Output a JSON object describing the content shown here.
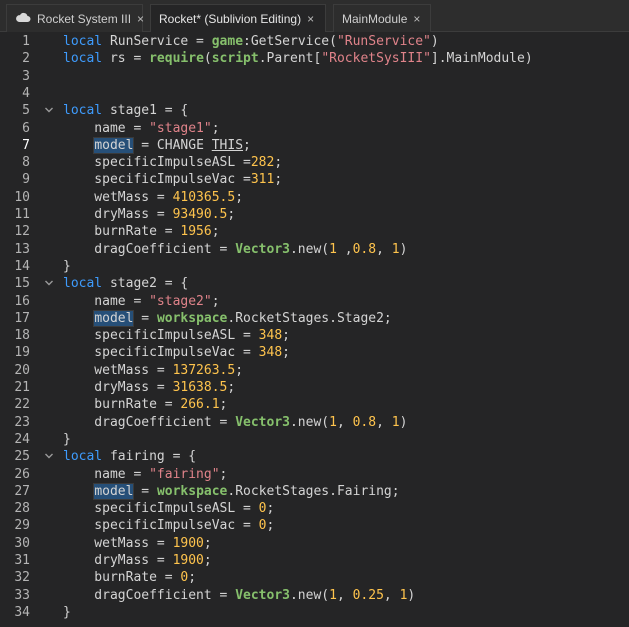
{
  "tabs": [
    {
      "label": "Rocket System III",
      "active": false,
      "icon": "cloud-icon"
    },
    {
      "label": "Rocket* (Sublivion Editing)",
      "active": true
    },
    {
      "label": "MainModule",
      "active": false
    }
  ],
  "close_glyph": "×",
  "current_line": 7,
  "colors": {
    "keyword": "#3e9bfc",
    "string": "#e0838a",
    "number": "#ffc44d",
    "builtin": "#86c06c",
    "text": "#d4d4d4",
    "background": "#252526"
  },
  "lines": [
    {
      "n": "1",
      "fold": false,
      "tokens": [
        {
          "t": "local",
          "c": "kw"
        },
        {
          "t": " RunService = "
        },
        {
          "t": "game",
          "c": "bi"
        },
        {
          "t": ":GetService("
        },
        {
          "t": "\"RunService\"",
          "c": "str"
        },
        {
          "t": ")"
        }
      ]
    },
    {
      "n": "2",
      "fold": false,
      "tokens": [
        {
          "t": "local",
          "c": "kw"
        },
        {
          "t": " rs = "
        },
        {
          "t": "require",
          "c": "bi"
        },
        {
          "t": "("
        },
        {
          "t": "script",
          "c": "bi"
        },
        {
          "t": ".Parent["
        },
        {
          "t": "\"RocketSysIII\"",
          "c": "str"
        },
        {
          "t": "].MainModule)"
        }
      ]
    },
    {
      "n": "3",
      "fold": false,
      "tokens": []
    },
    {
      "n": "4",
      "fold": false,
      "tokens": []
    },
    {
      "n": "5",
      "fold": true,
      "tokens": [
        {
          "t": "local",
          "c": "kw"
        },
        {
          "t": " stage1 = {"
        }
      ]
    },
    {
      "n": "6",
      "fold": false,
      "tokens": [
        {
          "t": "    name = "
        },
        {
          "t": "\"stage1\"",
          "c": "str"
        },
        {
          "t": ";"
        }
      ]
    },
    {
      "n": "7",
      "fold": false,
      "tokens": [
        {
          "t": "    "
        },
        {
          "t": "model",
          "c": "hl"
        },
        {
          "t": " = CHANGE "
        },
        {
          "t": "THIS",
          "c": "ul"
        },
        {
          "t": ";"
        }
      ]
    },
    {
      "n": "8",
      "fold": false,
      "tokens": [
        {
          "t": "    specificImpulseASL ="
        },
        {
          "t": "282",
          "c": "num"
        },
        {
          "t": ";"
        }
      ]
    },
    {
      "n": "9",
      "fold": false,
      "tokens": [
        {
          "t": "    specificImpulseVac ="
        },
        {
          "t": "311",
          "c": "num"
        },
        {
          "t": ";"
        }
      ]
    },
    {
      "n": "10",
      "fold": false,
      "tokens": [
        {
          "t": "    wetMass = "
        },
        {
          "t": "410365.5",
          "c": "num"
        },
        {
          "t": ";"
        }
      ]
    },
    {
      "n": "11",
      "fold": false,
      "tokens": [
        {
          "t": "    dryMass = "
        },
        {
          "t": "93490.5",
          "c": "num"
        },
        {
          "t": ";"
        }
      ]
    },
    {
      "n": "12",
      "fold": false,
      "tokens": [
        {
          "t": "    burnRate = "
        },
        {
          "t": "1956",
          "c": "num"
        },
        {
          "t": ";"
        }
      ]
    },
    {
      "n": "13",
      "fold": false,
      "tokens": [
        {
          "t": "    dragCoefficient = "
        },
        {
          "t": "Vector3",
          "c": "bi"
        },
        {
          "t": ".new("
        },
        {
          "t": "1",
          "c": "num"
        },
        {
          "t": " ,"
        },
        {
          "t": "0.8",
          "c": "num"
        },
        {
          "t": ", "
        },
        {
          "t": "1",
          "c": "num"
        },
        {
          "t": ")"
        }
      ]
    },
    {
      "n": "14",
      "fold": false,
      "tokens": [
        {
          "t": "}"
        }
      ]
    },
    {
      "n": "15",
      "fold": true,
      "tokens": [
        {
          "t": "local",
          "c": "kw"
        },
        {
          "t": " stage2 = {"
        }
      ]
    },
    {
      "n": "16",
      "fold": false,
      "tokens": [
        {
          "t": "    name = "
        },
        {
          "t": "\"stage2\"",
          "c": "str"
        },
        {
          "t": ";"
        }
      ]
    },
    {
      "n": "17",
      "fold": false,
      "tokens": [
        {
          "t": "    "
        },
        {
          "t": "model",
          "c": "hl"
        },
        {
          "t": " = "
        },
        {
          "t": "workspace",
          "c": "bi"
        },
        {
          "t": ".RocketStages.Stage2;"
        }
      ]
    },
    {
      "n": "18",
      "fold": false,
      "tokens": [
        {
          "t": "    specificImpulseASL = "
        },
        {
          "t": "348",
          "c": "num"
        },
        {
          "t": ";"
        }
      ]
    },
    {
      "n": "19",
      "fold": false,
      "tokens": [
        {
          "t": "    specificImpulseVac = "
        },
        {
          "t": "348",
          "c": "num"
        },
        {
          "t": ";"
        }
      ]
    },
    {
      "n": "20",
      "fold": false,
      "tokens": [
        {
          "t": "    wetMass = "
        },
        {
          "t": "137263.5",
          "c": "num"
        },
        {
          "t": ";"
        }
      ]
    },
    {
      "n": "21",
      "fold": false,
      "tokens": [
        {
          "t": "    dryMass = "
        },
        {
          "t": "31638.5",
          "c": "num"
        },
        {
          "t": ";"
        }
      ]
    },
    {
      "n": "22",
      "fold": false,
      "tokens": [
        {
          "t": "    burnRate = "
        },
        {
          "t": "266.1",
          "c": "num"
        },
        {
          "t": ";"
        }
      ]
    },
    {
      "n": "23",
      "fold": false,
      "tokens": [
        {
          "t": "    dragCoefficient = "
        },
        {
          "t": "Vector3",
          "c": "bi"
        },
        {
          "t": ".new("
        },
        {
          "t": "1",
          "c": "num"
        },
        {
          "t": ", "
        },
        {
          "t": "0.8",
          "c": "num"
        },
        {
          "t": ", "
        },
        {
          "t": "1",
          "c": "num"
        },
        {
          "t": ")"
        }
      ]
    },
    {
      "n": "24",
      "fold": false,
      "tokens": [
        {
          "t": "}"
        }
      ]
    },
    {
      "n": "25",
      "fold": true,
      "tokens": [
        {
          "t": "local",
          "c": "kw"
        },
        {
          "t": " fairing = {"
        }
      ]
    },
    {
      "n": "26",
      "fold": false,
      "tokens": [
        {
          "t": "    name = "
        },
        {
          "t": "\"fairing\"",
          "c": "str"
        },
        {
          "t": ";"
        }
      ]
    },
    {
      "n": "27",
      "fold": false,
      "tokens": [
        {
          "t": "    "
        },
        {
          "t": "model",
          "c": "hl"
        },
        {
          "t": " = "
        },
        {
          "t": "workspace",
          "c": "bi"
        },
        {
          "t": ".RocketStages.Fairing;"
        }
      ]
    },
    {
      "n": "28",
      "fold": false,
      "tokens": [
        {
          "t": "    specificImpulseASL = "
        },
        {
          "t": "0",
          "c": "num"
        },
        {
          "t": ";"
        }
      ]
    },
    {
      "n": "29",
      "fold": false,
      "tokens": [
        {
          "t": "    specificImpulseVac = "
        },
        {
          "t": "0",
          "c": "num"
        },
        {
          "t": ";"
        }
      ]
    },
    {
      "n": "30",
      "fold": false,
      "tokens": [
        {
          "t": "    wetMass = "
        },
        {
          "t": "1900",
          "c": "num"
        },
        {
          "t": ";"
        }
      ]
    },
    {
      "n": "31",
      "fold": false,
      "tokens": [
        {
          "t": "    dryMass = "
        },
        {
          "t": "1900",
          "c": "num"
        },
        {
          "t": ";"
        }
      ]
    },
    {
      "n": "32",
      "fold": false,
      "tokens": [
        {
          "t": "    burnRate = "
        },
        {
          "t": "0",
          "c": "num"
        },
        {
          "t": ";"
        }
      ]
    },
    {
      "n": "33",
      "fold": false,
      "tokens": [
        {
          "t": "    dragCoefficient = "
        },
        {
          "t": "Vector3",
          "c": "bi"
        },
        {
          "t": ".new("
        },
        {
          "t": "1",
          "c": "num"
        },
        {
          "t": ", "
        },
        {
          "t": "0.25",
          "c": "num"
        },
        {
          "t": ", "
        },
        {
          "t": "1",
          "c": "num"
        },
        {
          "t": ")"
        }
      ]
    },
    {
      "n": "34",
      "fold": false,
      "tokens": [
        {
          "t": "}"
        }
      ]
    }
  ]
}
